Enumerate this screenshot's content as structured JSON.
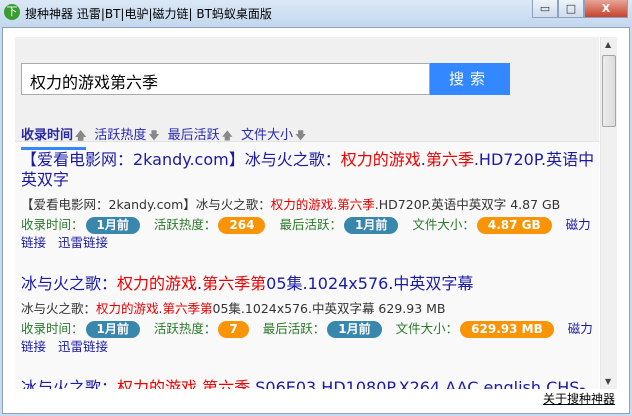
{
  "window": {
    "title": "搜种神器 迅雷|BT|电驴|磁力链|  BT蚂蚁桌面版",
    "logo": "下",
    "minimize": "▭",
    "maximize": "□",
    "close": "X"
  },
  "search": {
    "value": "权力的游戏第六季",
    "button": "搜索"
  },
  "tabs": [
    {
      "label": "收录时间",
      "arrow": "up-arrow-icon",
      "glyph": "🡅"
    },
    {
      "label": "活跃热度",
      "arrow": "down-arrow-icon",
      "glyph": "🡇"
    },
    {
      "label": "最后活跃",
      "arrow": "up-arrow-icon",
      "glyph": "🡅"
    },
    {
      "label": "文件大小",
      "arrow": "down-arrow-icon",
      "glyph": "🡇"
    }
  ],
  "meta_labels": {
    "time": "收录时间：",
    "heat": "活跃热度：",
    "last": "最后活跃：",
    "size": "文件大小：",
    "magnet": "磁力链接",
    "thunder": "迅雷链接"
  },
  "results": [
    {
      "title": [
        {
          "t": "【爱看电影网：2kandy.com】冰与火之歌：",
          "h": false
        },
        {
          "t": "权力的游戏",
          "h": true
        },
        {
          "t": ".",
          "h": false
        },
        {
          "t": "第六季",
          "h": true
        },
        {
          "t": ".HD720P.英语中英双字",
          "h": false
        }
      ],
      "desc": [
        {
          "t": "【爱看电影网：2kandy.com】冰与火之歌：",
          "h": false
        },
        {
          "t": "权力的游戏",
          "h": true
        },
        {
          "t": ".",
          "h": false
        },
        {
          "t": "第六季",
          "h": true
        },
        {
          "t": ".HD720P.英语中英双字   4.87 GB",
          "h": false
        }
      ],
      "time": "1月前",
      "heat": "264",
      "last": "1月前",
      "size": "4.87 GB"
    },
    {
      "title": [
        {
          "t": "冰与火之歌：",
          "h": false
        },
        {
          "t": "权力的游戏",
          "h": true
        },
        {
          "t": ".",
          "h": false
        },
        {
          "t": "第六季第",
          "h": true
        },
        {
          "t": "05集.1024x576.中英双字幕",
          "h": false
        }
      ],
      "desc": [
        {
          "t": "冰与火之歌：",
          "h": false
        },
        {
          "t": "权力的游戏",
          "h": true
        },
        {
          "t": ".",
          "h": false
        },
        {
          "t": "第六季第",
          "h": true
        },
        {
          "t": "05集.1024x576.中英双字幕   629.93 MB",
          "h": false
        }
      ],
      "time": "1月前",
      "heat": "7",
      "last": "1月前",
      "size": "629.93 MB"
    },
    {
      "title": [
        {
          "t": "冰与火之歌：",
          "h": false
        },
        {
          "t": "权力的游戏",
          "h": true
        },
        {
          "t": ".",
          "h": false
        },
        {
          "t": "第六季",
          "h": true
        },
        {
          "t": ".S06E03.HD1080P.X264.AAC.english.CHS-",
          "h": false
        }
      ],
      "desc": [],
      "time": "",
      "heat": "",
      "last": "",
      "size": ""
    }
  ],
  "footer": {
    "about": "关于搜种神器"
  },
  "colors": {
    "accent": "#3388ff",
    "badge_blue": "#3a87ad",
    "badge_orange": "#f89406",
    "highlight": "#ee0000",
    "link": "#1a1aa6",
    "meta": "#2a7a2a"
  }
}
